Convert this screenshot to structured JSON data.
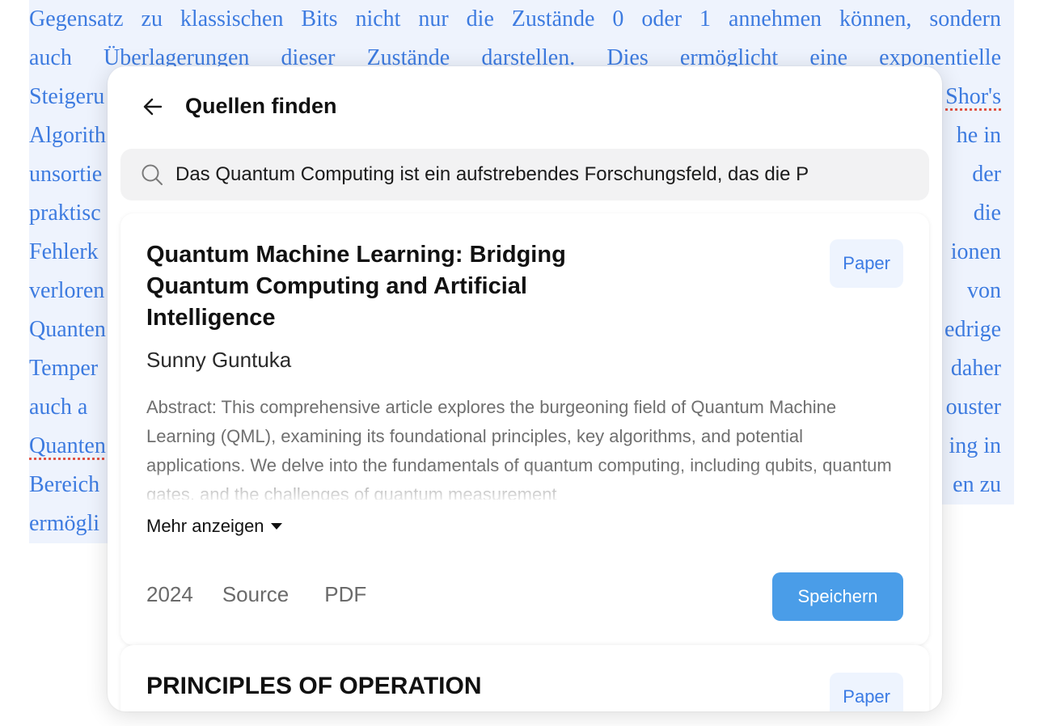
{
  "document": {
    "lines": [
      "Gegensatz zu klassischen Bits nicht nur die Zustände 0 oder 1 annehmen können, sondern",
      "auch Überlagerungen dieser Zustände darstellen. Dies ermöglicht eine exponentielle",
      "Steigeru",
      "Algorith",
      "unsortie",
      "praktisc",
      "Fehlerk",
      "verloren",
      "Quanten",
      "Temper",
      "auch a",
      "Quanten",
      "Bereich",
      "ermögli"
    ],
    "right_fragments": [
      "Shor's",
      "he in",
      "der",
      "die",
      "ionen",
      "von",
      "edrige",
      "daher",
      "ouster",
      "ing in",
      "en zu"
    ]
  },
  "panel": {
    "title": "Quellen finden",
    "search": {
      "value": "Das Quantum Computing ist ein aufstrebendes Forschungsfeld, das die P"
    }
  },
  "results": [
    {
      "title": "Quantum Machine Learning: Bridging Quantum Computing and Artificial Intelligence",
      "badge": "Paper",
      "authors": "Sunny Guntuka",
      "abstract": "Abstract: This comprehensive article explores the burgeoning field of Quantum Machine Learning (QML), examining its foundational principles, key algorithms, and potential applications. We delve into the fundamentals of quantum computing, including qubits, quantum gates, and the challenges of quantum measurement",
      "more_label": "Mehr anzeigen",
      "year": "2024",
      "source_label": "Source",
      "pdf_label": "PDF",
      "save_label": "Speichern"
    },
    {
      "title": "PRINCIPLES OF OPERATION",
      "badge": "Paper"
    }
  ],
  "colors": {
    "accent": "#4a9de8",
    "badge_text": "#3b7be4",
    "doc_text": "#3d7be0"
  }
}
